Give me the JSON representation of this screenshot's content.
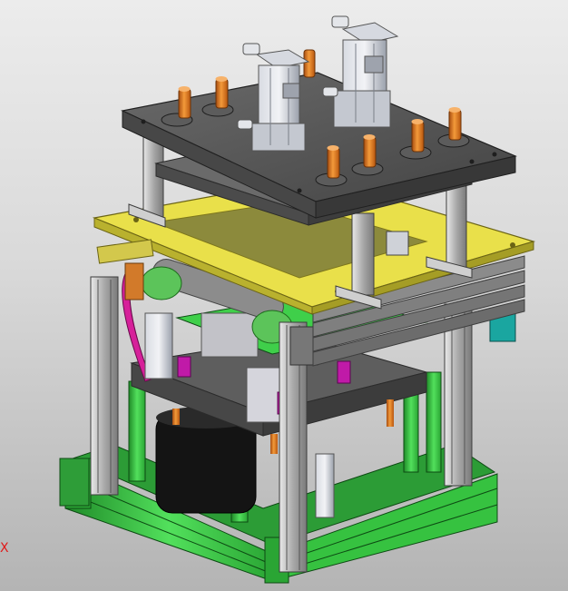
{
  "viewport": {
    "axis_label": "X",
    "colors": {
      "background_top": "#ececec",
      "background_bottom": "#b4b4b4",
      "frame_green": "#3fcf4a",
      "frame_green_dark": "#1f8a28",
      "plate_dark": "#5a5a5a",
      "plate_yellow": "#e9e04a",
      "cylinder_gray": "#b9bcc4",
      "pin_orange": "#e0701a",
      "magenta": "#c01aa8",
      "teal": "#1aa6a0"
    }
  }
}
